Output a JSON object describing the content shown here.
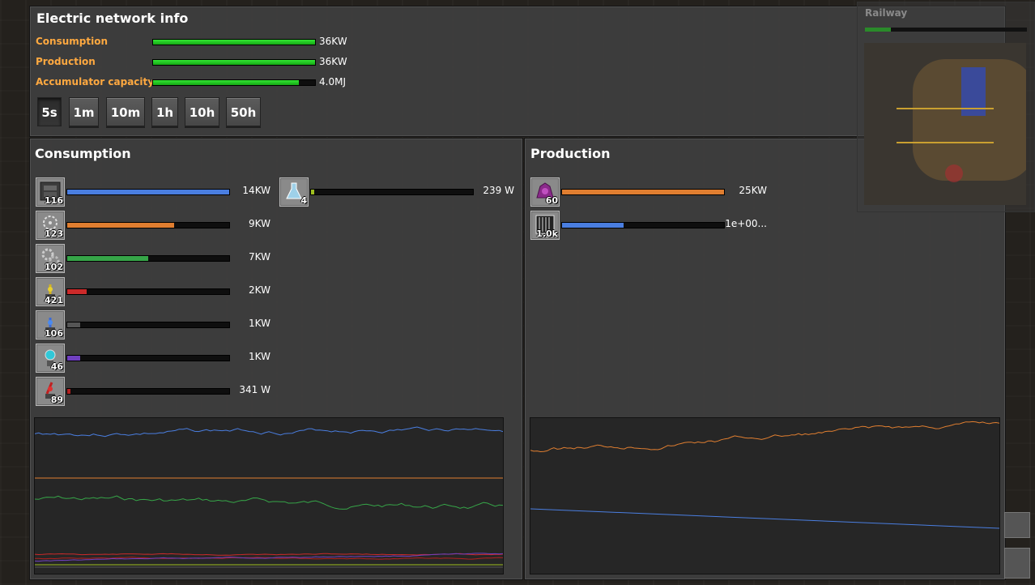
{
  "window": {
    "title": "Electric network info"
  },
  "summary": [
    {
      "label": "Consumption",
      "value": "36KW",
      "fill": 1.0
    },
    {
      "label": "Production",
      "value": "36KW",
      "fill": 1.0
    },
    {
      "label": "Accumulator capacity",
      "value": "4.0MJ",
      "fill": 0.9
    }
  ],
  "time_buttons": [
    {
      "label": "5s",
      "active": true
    },
    {
      "label": "1m",
      "active": false
    },
    {
      "label": "10m",
      "active": false
    },
    {
      "label": "1h",
      "active": false
    },
    {
      "label": "10h",
      "active": false
    },
    {
      "label": "50h",
      "active": false
    }
  ],
  "consumption": {
    "title": "Consumption",
    "items": [
      {
        "icon": "assembling-machine-icon",
        "count": "116",
        "value": "14KW",
        "fill": 1.0,
        "color": "#4a7ee0"
      },
      {
        "icon": "radar-icon",
        "count": "123",
        "value": "9KW",
        "fill": 0.66,
        "color": "#e07e30"
      },
      {
        "icon": "gear-icon",
        "count": "102",
        "value": "7KW",
        "fill": 0.5,
        "color": "#36a548"
      },
      {
        "icon": "inserter-icon",
        "count": "421",
        "value": "2KW",
        "fill": 0.12,
        "color": "#cc2a2a"
      },
      {
        "icon": "fast-inserter-icon",
        "count": "106",
        "value": "1KW",
        "fill": 0.08,
        "color": "#555555"
      },
      {
        "icon": "lamp-icon",
        "count": "46",
        "value": "1KW",
        "fill": 0.08,
        "color": "#7040c0"
      },
      {
        "icon": "long-inserter-icon",
        "count": "89",
        "value": "341 W",
        "fill": 0.02,
        "color": "#b02020"
      },
      {
        "icon": "lab-flask-icon",
        "count": "4",
        "value": "239 W",
        "fill": 0.02,
        "color": "#a0c020"
      }
    ]
  },
  "production": {
    "title": "Production",
    "items": [
      {
        "icon": "steam-engine-icon",
        "count": "60",
        "value": "25KW",
        "fill": 1.0,
        "color": "#e07e30"
      },
      {
        "icon": "accumulator-icon",
        "count": "1.0k",
        "value": "1e+00...",
        "fill": 0.38,
        "color": "#4a7ee0"
      }
    ]
  },
  "minimap": {
    "label": "Railway",
    "fill": 0.16
  }
}
